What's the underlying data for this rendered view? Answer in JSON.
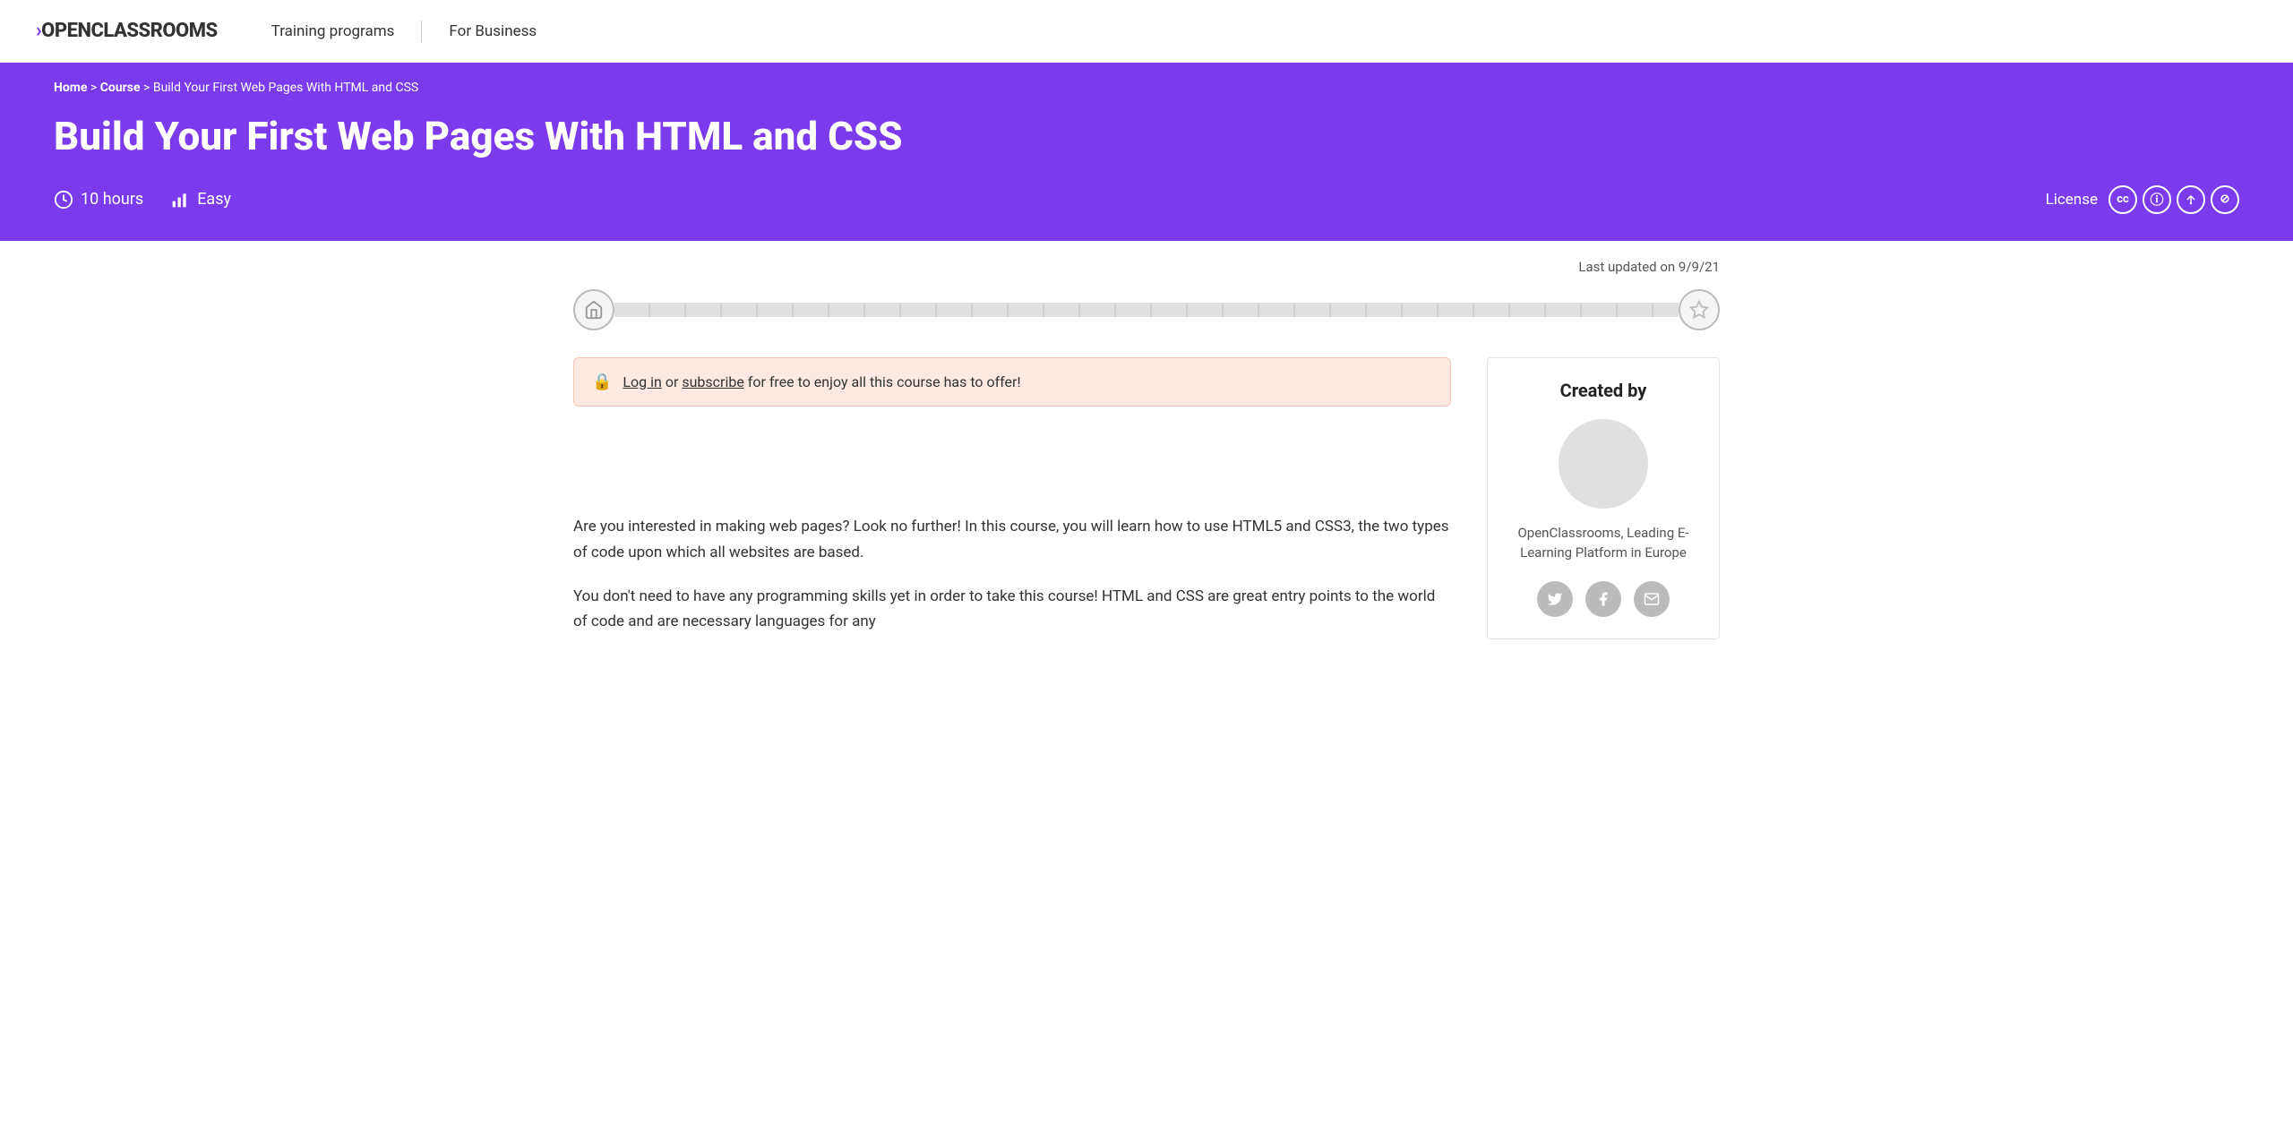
{
  "navbar": {
    "logo": "OPENCLASSROOMS",
    "logo_prefix": ">",
    "links": [
      {
        "label": "Training programs",
        "id": "training-programs"
      },
      {
        "label": "For Business",
        "id": "for-business"
      }
    ]
  },
  "hero": {
    "breadcrumb": {
      "parts": [
        "Home",
        "Course",
        "Build Your First Web Pages With HTML and CSS"
      ],
      "separator": " > "
    },
    "title": "Build Your First Web Pages With HTML and CSS",
    "meta": {
      "duration": "10 hours",
      "level": "Easy",
      "license_label": "License"
    }
  },
  "course": {
    "last_updated": "Last updated on 9/9/21",
    "alert": {
      "text_before_login": "",
      "login_link": "Log in",
      "text_middle": " or ",
      "subscribe_link": "subscribe",
      "text_after": " for free to enjoy all this course has to offer!"
    },
    "description": [
      "Are you interested in making web pages? Look no further! In this course, you will learn how to use HTML5 and CSS3, the two types of code upon which all websites are based.",
      "You don't need to have any programming skills yet in order to take this course! HTML and CSS are great entry points to the world of code and are necessary languages for any"
    ]
  },
  "sidebar": {
    "title": "Created by",
    "author": "OpenClassrooms, Leading E-Learning Platform in Europe",
    "social": [
      {
        "icon": "twitter",
        "label": "Twitter"
      },
      {
        "icon": "facebook",
        "label": "Facebook"
      },
      {
        "icon": "email",
        "label": "Email"
      }
    ]
  },
  "icons": {
    "clock": "⏱",
    "bar_chart": "📶",
    "home": "🏠",
    "trophy": "🏆",
    "lock": "🔒",
    "cc": "CC",
    "info": "ⓘ",
    "share": "Ⓢ",
    "circle_c": "Ⓒ",
    "twitter": "🐦",
    "facebook": "f",
    "email": "✉"
  }
}
